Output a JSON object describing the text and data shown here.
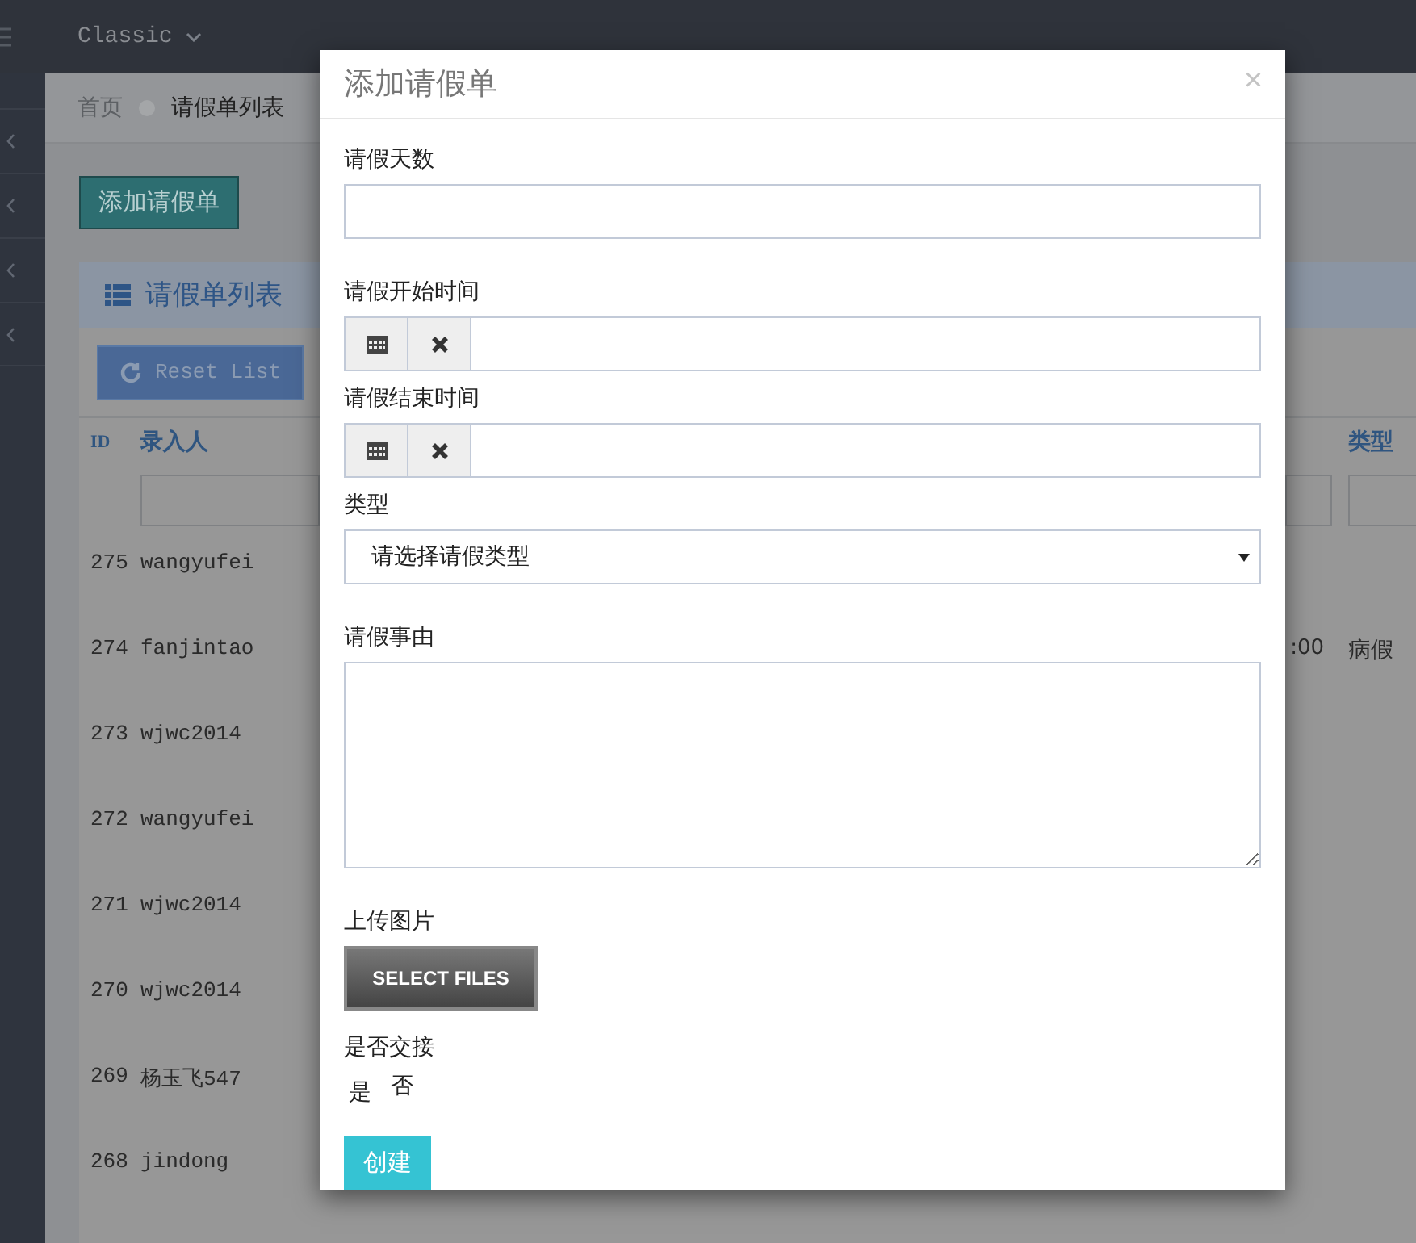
{
  "top_bar": {
    "theme_menu": "Classic"
  },
  "breadcrumb": [
    "首页",
    "请假单列表"
  ],
  "add_button": "添加请假单",
  "panel": {
    "title": "请假单列表",
    "reset_button": "Reset List",
    "table": {
      "columns": [
        "ID",
        "录入人",
        "类型"
      ],
      "rows": [
        {
          "id": "275",
          "entered_by": "wangyufei"
        },
        {
          "id": "274",
          "entered_by": "fanjintao",
          "column_3": ":00",
          "type": "病假"
        },
        {
          "id": "273",
          "entered_by": "wjwc2014"
        },
        {
          "id": "272",
          "entered_by": "wangyufei"
        },
        {
          "id": "271",
          "entered_by": "wjwc2014"
        },
        {
          "id": "270",
          "entered_by": "wjwc2014"
        },
        {
          "id": "269",
          "entered_by": "杨玉飞547"
        },
        {
          "id": "268",
          "entered_by": "jindong"
        }
      ]
    }
  },
  "modal": {
    "title": "添加请假单",
    "close": "×",
    "fields": [
      {
        "kind": "text",
        "label": "请假天数"
      },
      {
        "kind": "date",
        "label": "请假开始时间"
      },
      {
        "kind": "date",
        "label": "请假结束时间"
      },
      {
        "kind": "select",
        "label": "类型",
        "value": "请选择请假类型"
      },
      {
        "kind": "textarea",
        "label": "请假事由"
      },
      {
        "kind": "file",
        "label": "上传图片",
        "button": "SELECT FILES"
      },
      {
        "kind": "radio",
        "label": "是否交接",
        "options": [
          "是",
          "否"
        ]
      }
    ],
    "submit": "创建"
  }
}
